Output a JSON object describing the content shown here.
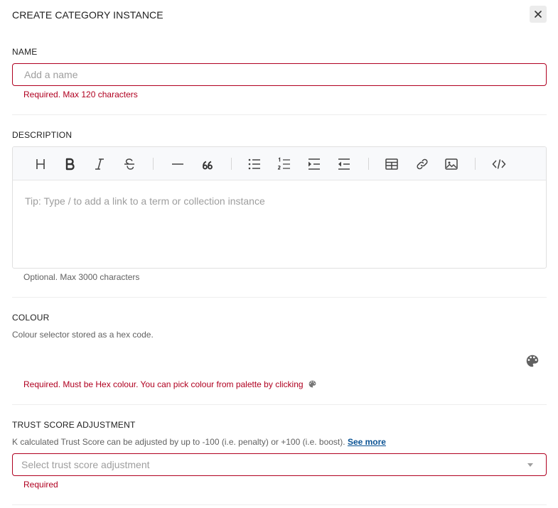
{
  "dialog": {
    "title": "CREATE CATEGORY INSTANCE",
    "close_icon": "close-icon"
  },
  "name": {
    "label": "NAME",
    "placeholder": "Add a name",
    "value": "",
    "error": "Required. Max 120 characters"
  },
  "description": {
    "label": "DESCRIPTION",
    "placeholder": "Tip: Type / to add a link to a term or collection instance",
    "helper": "Optional. Max 3000 characters",
    "toolbar": [
      "heading-icon",
      "bold-icon",
      "italic-icon",
      "strikethrough-icon",
      "horizontal-rule-icon",
      "quote-icon",
      "bullet-list-icon",
      "numbered-list-icon",
      "indent-icon",
      "outdent-icon",
      "table-icon",
      "link-icon",
      "image-icon",
      "code-icon"
    ]
  },
  "colour": {
    "label": "COLOUR",
    "helper": "Colour selector stored as a hex code.",
    "error": "Required. Must be Hex colour. You can pick colour from palette by clicking",
    "icon": "palette-icon"
  },
  "trust": {
    "label": "TRUST SCORE ADJUSTMENT",
    "helper": "K calculated Trust Score can be adjusted by up to -100 (i.e. penalty) or +100 (i.e. boost).",
    "link": "See more",
    "placeholder": "Select trust score adjustment",
    "error": "Required"
  },
  "colors": {
    "error": "#b00020",
    "link": "#0b5394",
    "toolbar_bg": "#f8f9fb"
  }
}
